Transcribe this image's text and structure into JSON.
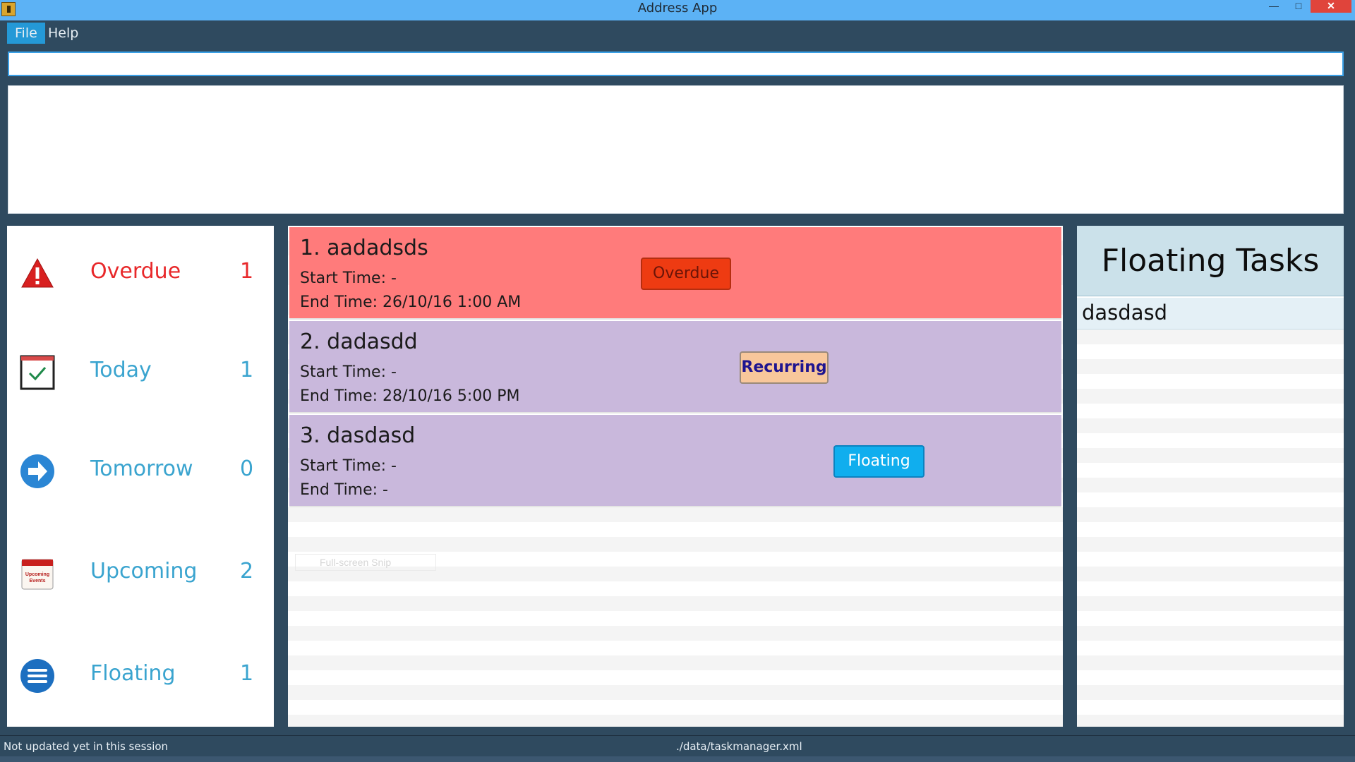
{
  "window": {
    "title": "Address App",
    "controls": {
      "minimize": "—",
      "maximize": "□",
      "close": "✕"
    }
  },
  "menu": {
    "items": [
      {
        "label": "File"
      },
      {
        "label": "Help"
      }
    ]
  },
  "command": {
    "value": "",
    "placeholder": ""
  },
  "result": {
    "text": ""
  },
  "sidebar": {
    "items": [
      {
        "label": "Overdue",
        "count": "1",
        "icon": "warning-triangle-icon"
      },
      {
        "label": "Today",
        "count": "1",
        "icon": "calendar-check-icon"
      },
      {
        "label": "Tomorrow",
        "count": "0",
        "icon": "arrow-right-circle-icon"
      },
      {
        "label": "Upcoming",
        "count": "2",
        "icon": "upcoming-events-calendar-icon",
        "icon_text": "Upcoming Events"
      },
      {
        "label": "Floating",
        "count": "1",
        "icon": "list-lines-circle-icon"
      }
    ]
  },
  "tasks": [
    {
      "name": "1. aadadsds",
      "start": "Start Time: -",
      "end": "End Time: 26/10/16 1:00 AM",
      "tag": "Overdue",
      "bg": "#ff7b7b"
    },
    {
      "name": "2. dadasdd",
      "start": "Start Time: -",
      "end": "End Time: 28/10/16 5:00 PM",
      "tag": "Recurring",
      "bg": "#c9b8dc"
    },
    {
      "name": "3. dasdasd",
      "start": "Start Time: -",
      "end": "End Time: -",
      "tag": "Floating",
      "bg": "#c9b8dc"
    }
  ],
  "ghost": {
    "text": "Full-screen Snip"
  },
  "floating": {
    "title": "Floating Tasks",
    "items": [
      "dasdasd"
    ]
  },
  "status": {
    "left": "Not updated yet in this session",
    "right": "./data/taskmanager.xml"
  }
}
